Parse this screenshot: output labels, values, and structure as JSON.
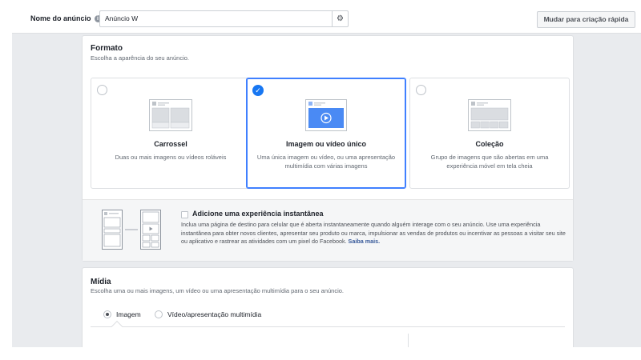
{
  "topbar": {
    "ad_name_label": "Nome do anúncio",
    "ad_name_value": "Anúncio W",
    "quick_create_label": "Mudar para criação rápida"
  },
  "format": {
    "title": "Formato",
    "subtitle": "Escolha a aparência do seu anúncio.",
    "options": [
      {
        "title": "Carrossel",
        "description": "Duas ou mais imagens ou vídeos roláveis",
        "selected": false
      },
      {
        "title": "Imagem ou vídeo único",
        "description": "Uma única imagem ou vídeo, ou uma apresentação multimídia com várias imagens",
        "selected": true
      },
      {
        "title": "Coleção",
        "description": "Grupo de imagens que são abertas em uma experiência móvel em tela cheia",
        "selected": false
      }
    ],
    "instant": {
      "title": "Adicione uma experiência instantânea",
      "description": "Inclua uma página de destino para celular que é aberta instantaneamente quando alguém interage com o seu anúncio. Use uma experiência instantânea para obter novos clientes, apresentar seu produto ou marca, impulsionar as vendas de produtos ou incentivar as pessoas a visitar seu site ou aplicativo e rastrear as atividades com um pixel do Facebook.",
      "learn_more": "Saiba mais."
    }
  },
  "media": {
    "title": "Mídia",
    "subtitle": "Escolha uma ou mais imagens, um vídeo ou uma apresentação multimídia para o seu anúncio.",
    "options": [
      {
        "label": "Imagem",
        "selected": true
      },
      {
        "label": "Vídeo/apresentação multimídia",
        "selected": false
      }
    ]
  },
  "colors": {
    "accent": "#1877f2",
    "selected_border": "#4080ff",
    "link": "#365899"
  }
}
